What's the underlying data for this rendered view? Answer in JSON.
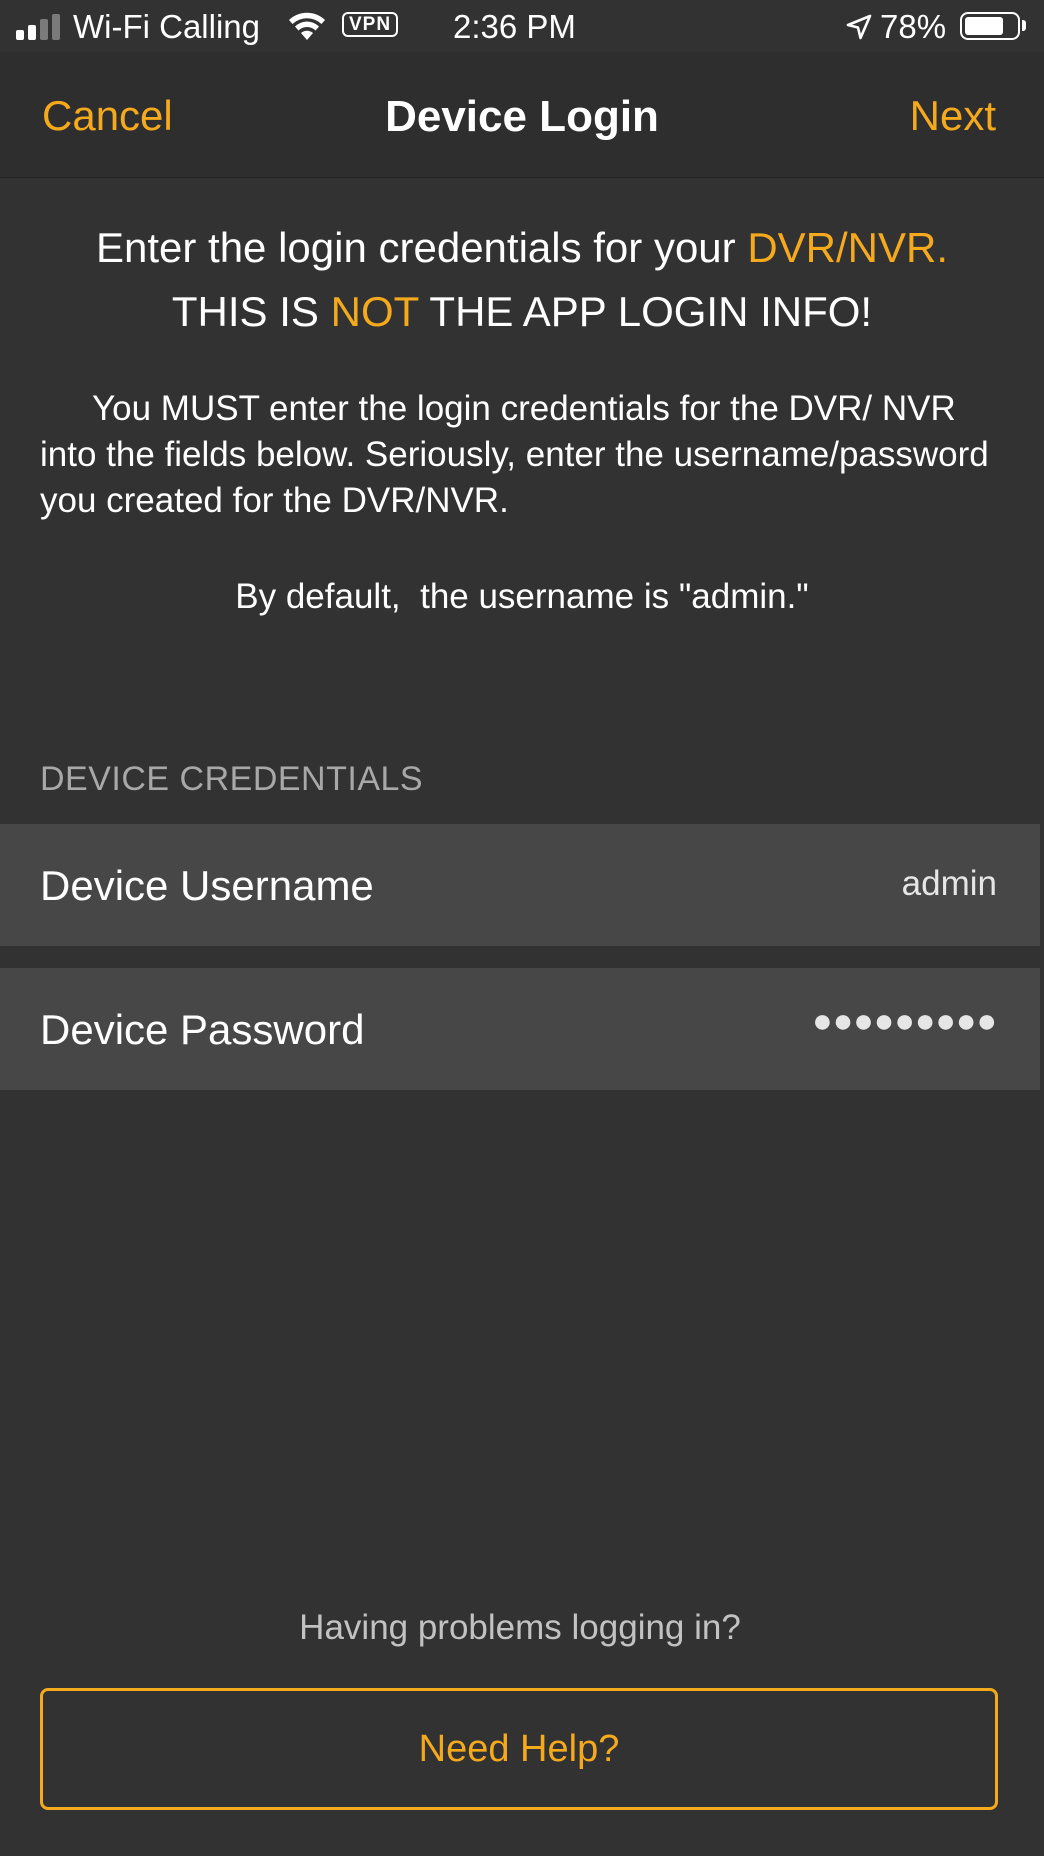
{
  "status_bar": {
    "carrier": "Wi-Fi Calling",
    "vpn": "VPN",
    "time": "2:36 PM",
    "battery": "78%",
    "battery_level": 0.78
  },
  "nav": {
    "cancel": "Cancel",
    "title": "Device Login",
    "next": "Next"
  },
  "instructions": {
    "line1_prefix": "Enter the login credentials for your ",
    "line1_highlight": "DVR/NVR.",
    "line2_prefix": "THIS IS ",
    "line2_highlight": "NOT",
    "line2_suffix": " THE APP LOGIN INFO!",
    "body": "You MUST enter the login credentials for the DVR/ NVR into the fields below. Seriously, enter the username/password you created for the DVR/NVR.",
    "default_note": "By default,  the username is \"admin.\""
  },
  "credentials": {
    "section_header": "DEVICE CREDENTIALS",
    "username_label": "Device Username",
    "username_value": "admin",
    "password_label": "Device Password",
    "password_value": "●●●●●●●●●"
  },
  "help": {
    "prompt": "Having problems logging in?",
    "button": "Need Help?"
  },
  "colors": {
    "accent": "#f5a91d",
    "background": "#323232",
    "row": "#474747"
  }
}
